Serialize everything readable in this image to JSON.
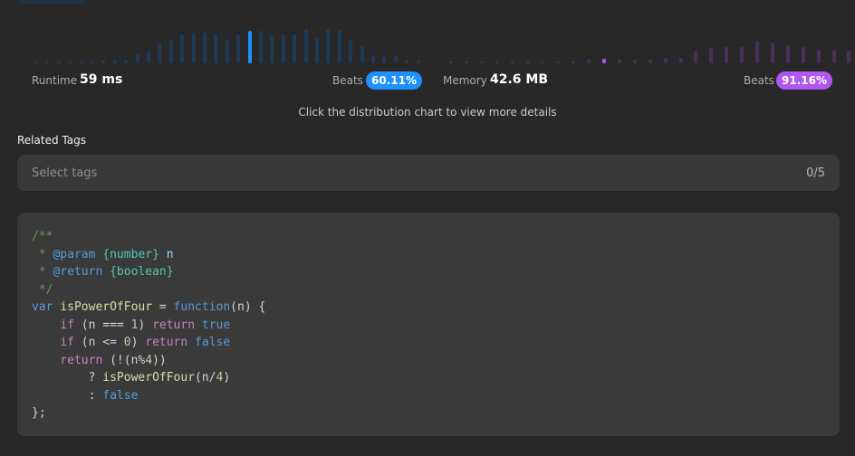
{
  "colors": {
    "runtime_bar": "#1e3a57",
    "runtime_highlight": "#1e90ff",
    "memory_bar": "#47305a",
    "memory_highlight": "#b157f0",
    "runtime_badge": "#1e90ff",
    "memory_badge": "#b157f0"
  },
  "runtime": {
    "label": "Runtime",
    "value": "59 ms",
    "beats_label": "Beats",
    "beats_value": "60.11%",
    "distribution": [
      0.03,
      0.03,
      0.03,
      0.03,
      0.03,
      0.03,
      0.08,
      0.08,
      0.08,
      0.25,
      0.32,
      0.48,
      0.58,
      0.72,
      0.75,
      0.75,
      0.72,
      0.58,
      0.72,
      0.8,
      0.8,
      0.7,
      0.72,
      0.72,
      0.85,
      0.62,
      0.85,
      0.82,
      0.58,
      0.43,
      0.2,
      0.18,
      0.2,
      0.08,
      0.08
    ],
    "highlight_index": 19
  },
  "memory": {
    "label": "Memory",
    "value": "42.6 MB",
    "beats_label": "Beats",
    "beats_value": "91.16%",
    "distribution": [
      0.04,
      0.04,
      0.04,
      0.04,
      0.04,
      0.04,
      0.04,
      0.04,
      0.04,
      0.12,
      0.1,
      0.08,
      0.08,
      0.12,
      0.14,
      0.14,
      0.3,
      0.38,
      0.4,
      0.4,
      0.55,
      0.5,
      0.45,
      0.4,
      0.34,
      0.34,
      0.3,
      0.22
    ],
    "highlight_index": 10
  },
  "hint": "Click the distribution chart to view more details",
  "related_tags": {
    "title": "Related Tags",
    "placeholder": "Select tags",
    "count": "0/5"
  },
  "code": {
    "language": "javascript",
    "lines": [
      "/**",
      " * @param {number} n",
      " * @return {boolean}",
      " */",
      "var isPowerOfFour = function(n) {",
      "    if (n === 1) return true",
      "    if (n <= 0) return false",
      "    return (!(n%4))",
      "        ? isPowerOfFour(n/4)",
      "        : false",
      "};"
    ]
  }
}
